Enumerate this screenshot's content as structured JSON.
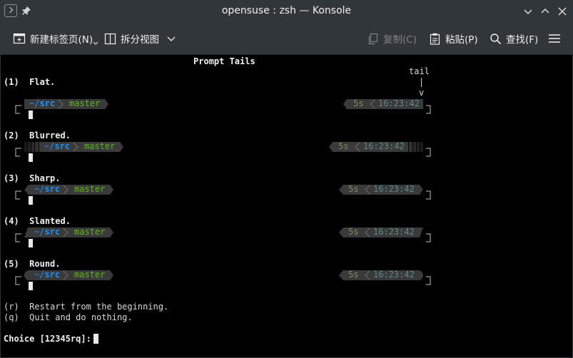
{
  "window": {
    "title": "opensuse : zsh — Konsole"
  },
  "toolbar": {
    "new_tab": "新建标签页(N)",
    "split_view": "拆分视图",
    "copy": "复制(C)",
    "paste": "粘贴(P)",
    "find": "查找(F)"
  },
  "terminal": {
    "heading": "Prompt Tails",
    "tail_label": "tail",
    "tail_bar": "|",
    "tail_v": "v",
    "options": [
      {
        "key": "(1)",
        "name": "Flat."
      },
      {
        "key": "(2)",
        "name": "Blurred."
      },
      {
        "key": "(3)",
        "name": "Sharp."
      },
      {
        "key": "(4)",
        "name": "Slanted."
      },
      {
        "key": "(5)",
        "name": "Round."
      }
    ],
    "left_prompt": {
      "dir_prefix": "~/",
      "dir": "src",
      "branch": "master"
    },
    "right_prompt": {
      "duration": "5s",
      "time": "16:23:42"
    },
    "restart": "(r)  Restart from the beginning.",
    "quit": "(q)  Quit and do nothing.",
    "choice": "Choice [12345rq]: "
  },
  "colors": {
    "segment_bg": "#3a3a3a",
    "dir_blue": "#1e90ff",
    "branch_green": "#5fb21e",
    "right_text": "#5f8787",
    "duration_text": "#87875f"
  }
}
